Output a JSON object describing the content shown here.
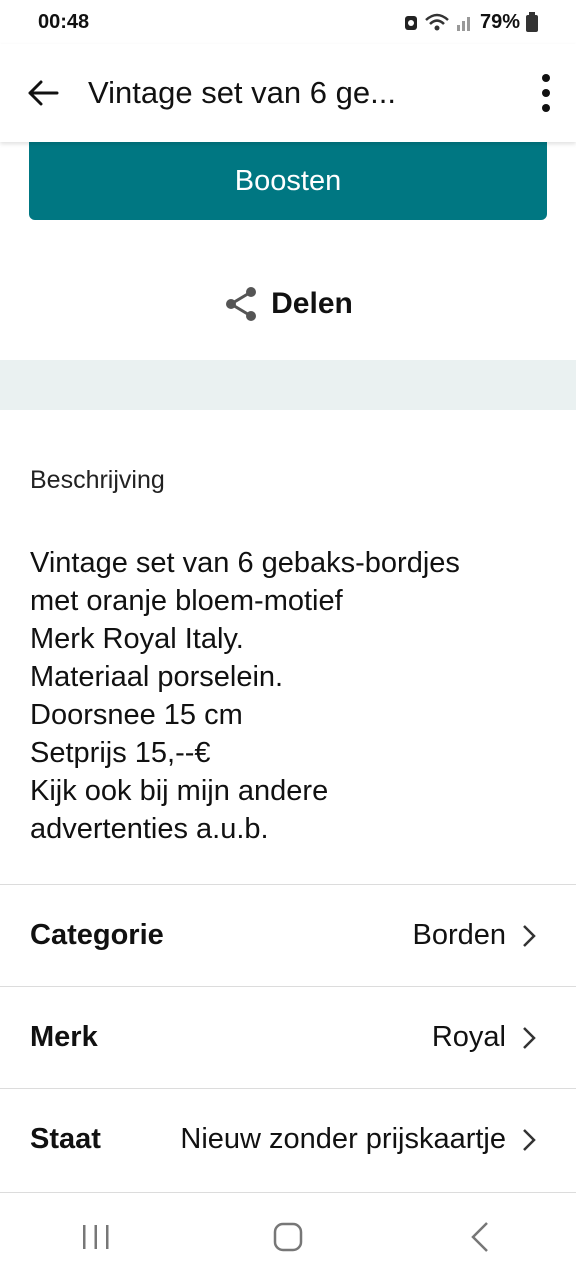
{
  "status_bar": {
    "time": "00:48",
    "battery": "79%"
  },
  "app_bar": {
    "title": "Vintage set van 6 ge..."
  },
  "actions": {
    "boost_label": "Boosten",
    "share_label": "Delen"
  },
  "description": {
    "title": "Beschrijving",
    "lines": [
      "Vintage set van 6 gebaks-bordjes",
      "met oranje bloem-motief",
      "Merk Royal Italy.",
      "Materiaal porselein.",
      "Doorsnee 15 cm",
      "Setprijs 15,--€",
      "Kijk ook bij mijn andere",
      "advertenties a.u.b."
    ]
  },
  "attributes": [
    {
      "label": "Categorie",
      "value": "Borden"
    },
    {
      "label": "Merk",
      "value": "Royal"
    },
    {
      "label": "Staat",
      "value": "Nieuw zonder prijskaartje"
    }
  ],
  "colors": {
    "accent": "#007782",
    "band": "#eaf1f1"
  },
  "icons": [
    "back-arrow-icon",
    "more-vert-icon",
    "share-icon",
    "chevron-right-icon",
    "recent-apps-icon",
    "home-icon",
    "nav-back-icon"
  ]
}
